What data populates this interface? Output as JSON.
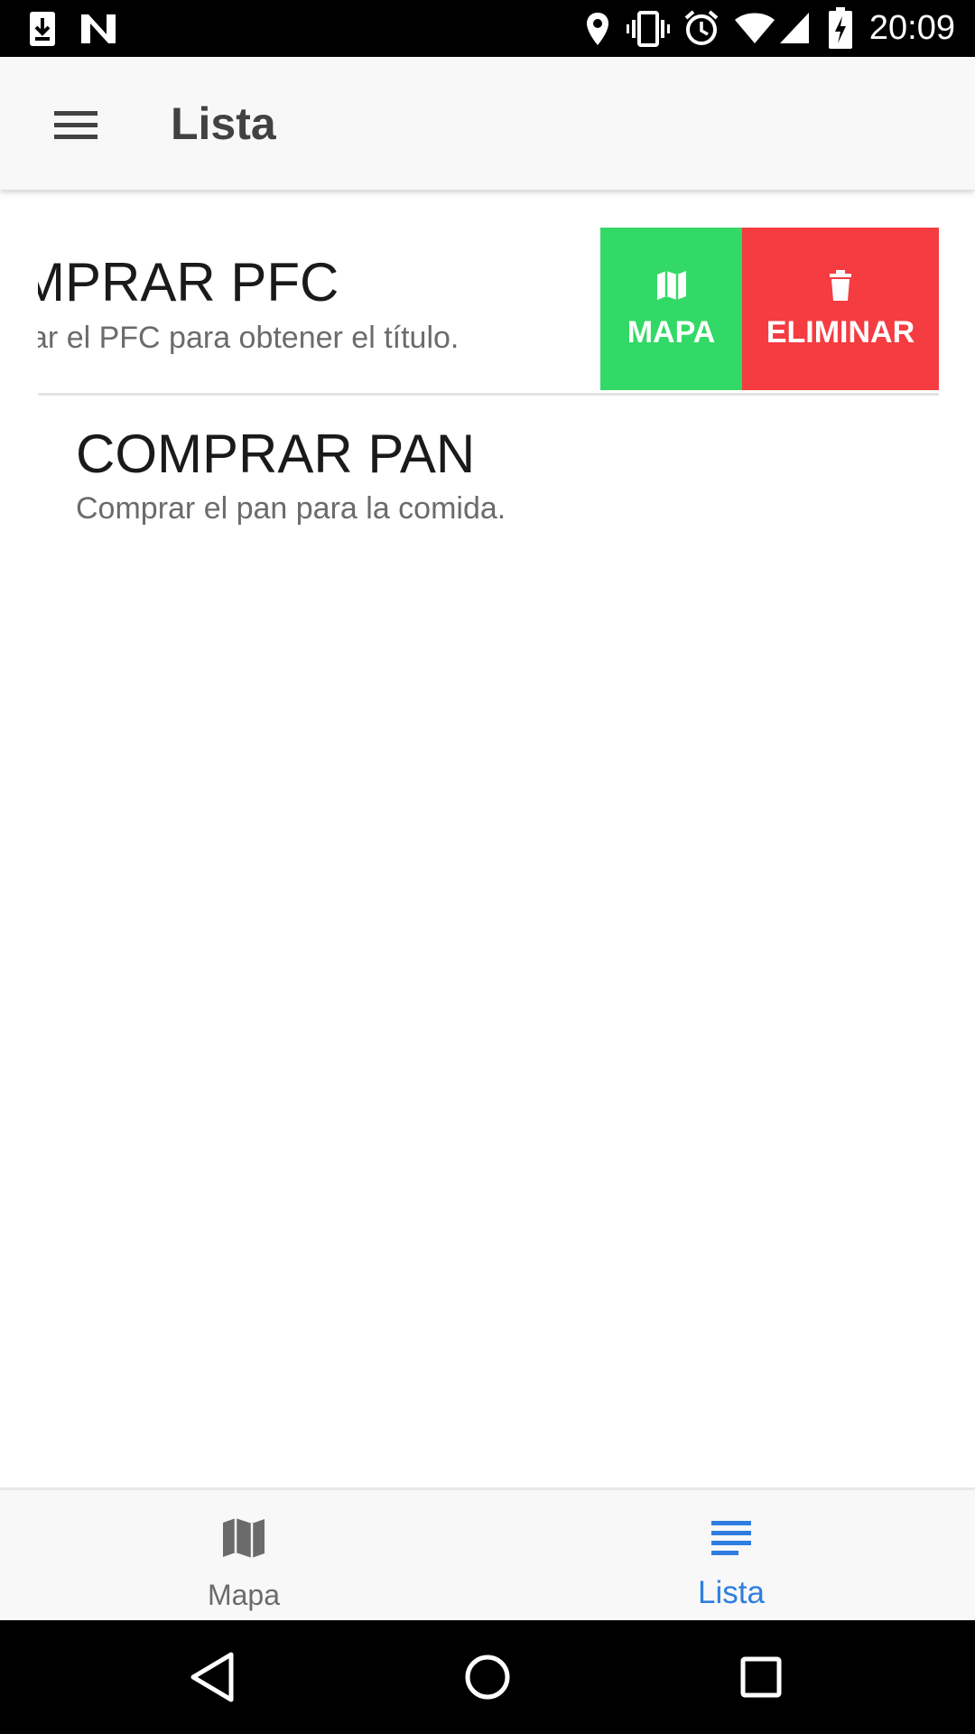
{
  "status_bar": {
    "time": "20:09",
    "icons": [
      "download-icon",
      "notification-n-icon",
      "location-icon",
      "vibrate-icon",
      "alarm-icon",
      "wifi-icon",
      "cell-signal-icon",
      "battery-charging-icon"
    ]
  },
  "app_bar": {
    "title": "Lista",
    "menu_icon": "hamburger-menu-icon"
  },
  "list": {
    "items": [
      {
        "title": "COMPRAR PFC",
        "subtitle": "Terminar el PFC para obtener el título.",
        "swiped": true,
        "actions": [
          {
            "label": "MAPA",
            "icon": "map-icon",
            "color": "#33d966"
          },
          {
            "label": "ELIMINAR",
            "icon": "trash-icon",
            "color": "#f53c41"
          }
        ]
      },
      {
        "title": "COMPRAR PAN",
        "subtitle": "Comprar el pan para la comida.",
        "swiped": false
      }
    ]
  },
  "bottom_nav": {
    "items": [
      {
        "label": "Mapa",
        "icon": "map-icon",
        "active": false
      },
      {
        "label": "Lista",
        "icon": "list-icon",
        "active": true
      }
    ],
    "active_color": "#2f7de1",
    "inactive_color": "#6b6b6b"
  },
  "system_nav": {
    "buttons": [
      "back-icon",
      "home-icon",
      "recents-icon"
    ]
  }
}
